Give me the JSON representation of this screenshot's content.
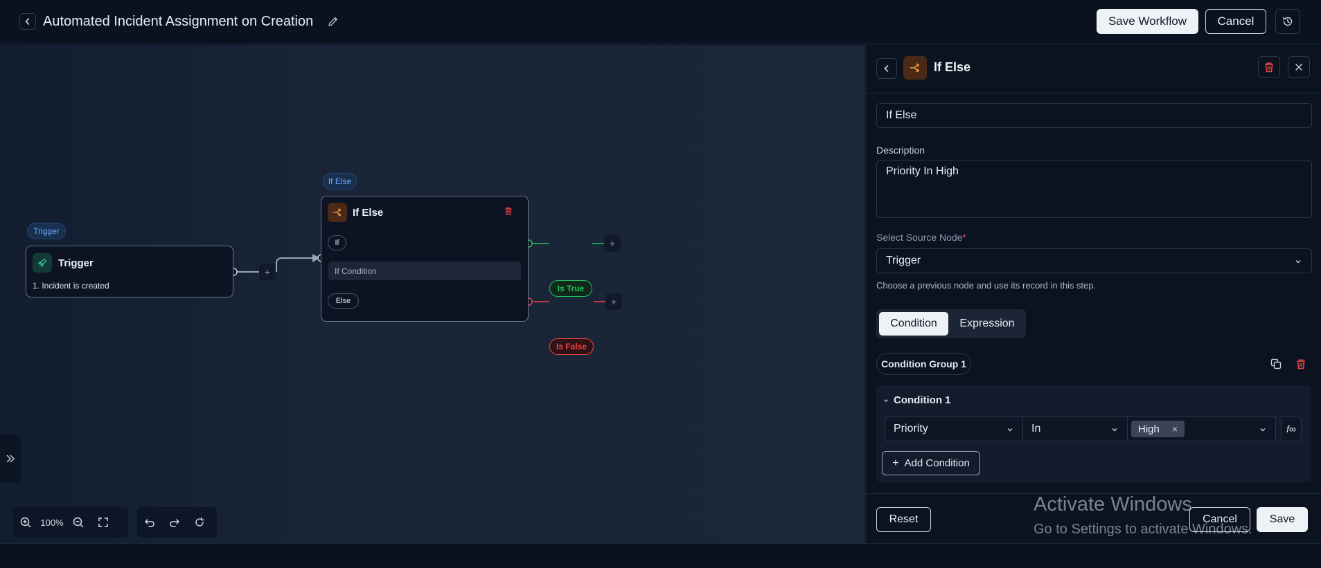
{
  "header": {
    "title": "Automated Incident Assignment on Creation",
    "save_workflow": "Save Workflow",
    "cancel": "Cancel"
  },
  "canvas": {
    "trigger_pill": "Trigger",
    "ifelse_pill": "If Else",
    "trigger_node": {
      "title": "Trigger",
      "text": "1. Incident is created"
    },
    "ifelse_node": {
      "title": "If Else",
      "if_label": "If",
      "condition_text": "If Condition",
      "else_label": "Else"
    },
    "is_true": "Is True",
    "is_false": "Is False",
    "zoom": "100%"
  },
  "panel": {
    "title": "If Else",
    "name_value": "If Else",
    "description_label": "Description",
    "description_value": "Priority In High",
    "source_label": "Select Source Node",
    "required_mark": "*",
    "source_value": "Trigger",
    "source_helper": "Choose a previous node and use its record in this step.",
    "tabs": [
      "Condition",
      "Expression"
    ],
    "group_label": "Condition Group 1",
    "condition_title": "Condition 1",
    "field": "Priority",
    "operator": "In",
    "value_tag": "High",
    "fx": "f∞",
    "add_condition": "Add Condition",
    "reset": "Reset",
    "cancel": "Cancel",
    "save": "Save"
  },
  "watermark": {
    "line1": "Activate Windows",
    "line2": "Go to Settings to activate Windows."
  },
  "colors": {
    "accent_green": "#22c55e",
    "accent_red": "#ef4444",
    "accent_orange": "#f59e42",
    "accent_blue": "#6ea8ff"
  }
}
